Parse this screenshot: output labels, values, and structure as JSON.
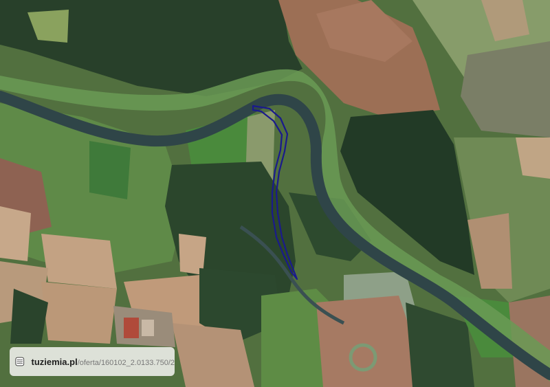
{
  "map": {
    "type": "satellite",
    "icon": "topography-logo-icon",
    "parcel_outline_color": "#1a1a8c",
    "river_color": "#2f4548"
  },
  "badge": {
    "site": "tuziemia.pl",
    "path": "/oferta/160102_2.0133.750/2"
  }
}
